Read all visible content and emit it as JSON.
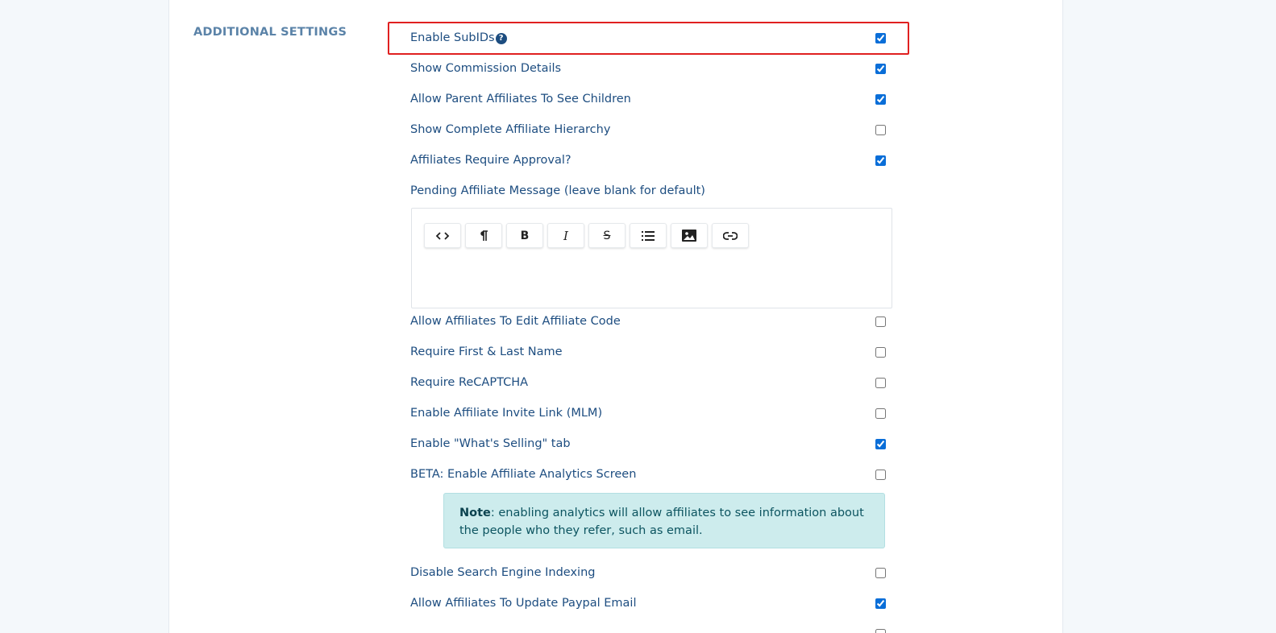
{
  "section": {
    "title": "ADDITIONAL SETTINGS"
  },
  "settings": [
    {
      "label": "Enable SubIDs",
      "checked": true,
      "help_icon": "question-circle-icon",
      "highlighted": true
    },
    {
      "label": "Show Commission Details",
      "checked": true
    },
    {
      "label": "Allow Parent Affiliates To See Children",
      "checked": true
    },
    {
      "label": "Show Complete Affiliate Hierarchy",
      "checked": false
    },
    {
      "label": "Affiliates Require Approval?",
      "checked": true
    },
    {
      "label": "Pending Affiliate Message (leave blank for default)"
    },
    {
      "label": "Allow Affiliates To Edit Affiliate Code",
      "checked": false
    },
    {
      "label": "Require First & Last Name",
      "checked": false
    },
    {
      "label": "Require ReCAPTCHA",
      "checked": false
    },
    {
      "label": "Enable Affiliate Invite Link (MLM)",
      "checked": false
    },
    {
      "label": "Enable \"What's Selling\" tab",
      "checked": true
    },
    {
      "label": "BETA: Enable Affiliate Analytics Screen",
      "checked": false
    },
    {
      "label": "Disable Search Engine Indexing",
      "checked": false
    },
    {
      "label": "Allow Affiliates To Update Paypal Email",
      "checked": true
    },
    {
      "label": "",
      "checked": false
    }
  ],
  "editor": {
    "toolbar": [
      {
        "name": "code-view-icon",
        "title": "Code view"
      },
      {
        "name": "paragraph-icon",
        "title": "Paragraph"
      },
      {
        "name": "bold-icon",
        "title": "Bold"
      },
      {
        "name": "italic-icon",
        "title": "Italic"
      },
      {
        "name": "strikethrough-icon",
        "title": "Strikethrough"
      },
      {
        "name": "list-icon",
        "title": "List"
      },
      {
        "name": "image-icon",
        "title": "Image"
      },
      {
        "name": "link-icon",
        "title": "Link"
      }
    ],
    "content": ""
  },
  "note": {
    "label": "Note",
    "text": ": enabling analytics will allow affiliates to see information about the people who they refer, such as email."
  },
  "colors": {
    "label": "#1d4d80",
    "section_title": "#5b83a8",
    "highlight": "#e02020",
    "note_bg": "#cdeced",
    "note_text": "#0c5460",
    "checkbox_accent": "#0a6ed8"
  }
}
